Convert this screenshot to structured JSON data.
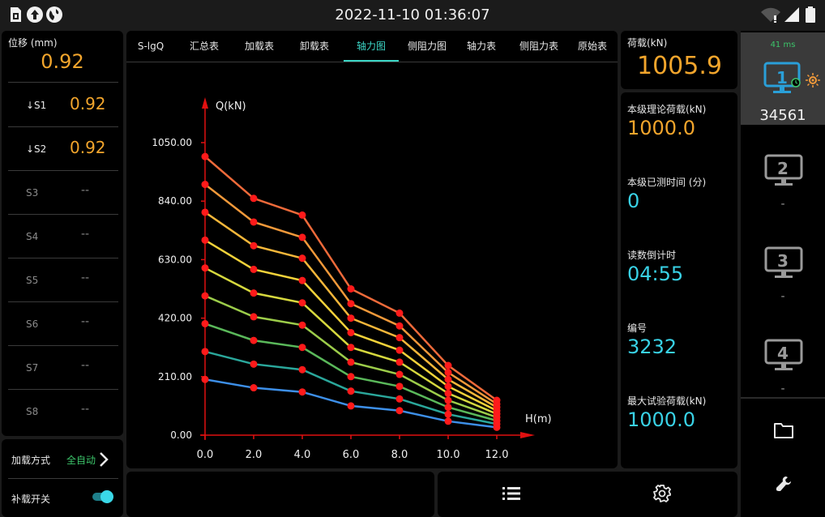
{
  "status": {
    "datetime": "2022-11-10 01:36:07",
    "left_icons": [
      "sim-card-icon",
      "upload-circle-icon",
      "globe-icon"
    ],
    "right_icons": [
      "wifi-off-icon",
      "signal-icon",
      "battery-icon"
    ]
  },
  "left": {
    "displacement_label": "位移 (mm)",
    "displacement_value": "0.92",
    "sensors": [
      {
        "label": "↓S1",
        "value": "0.92"
      },
      {
        "label": "↓S2",
        "value": "0.92"
      },
      {
        "label": "S3",
        "value": "--"
      },
      {
        "label": "S4",
        "value": "--"
      },
      {
        "label": "S5",
        "value": "--"
      },
      {
        "label": "S6",
        "value": "--"
      },
      {
        "label": "S7",
        "value": "--"
      },
      {
        "label": "S8",
        "value": "--"
      }
    ],
    "load_mode_label": "加载方式",
    "load_mode_value": "全自动",
    "supplement_label": "补载开关",
    "supplement_on": true
  },
  "tabs": [
    {
      "label": "S-lgQ",
      "active": false
    },
    {
      "label": "汇总表",
      "active": false
    },
    {
      "label": "加载表",
      "active": false
    },
    {
      "label": "卸载表",
      "active": false
    },
    {
      "label": "轴力图",
      "active": true
    },
    {
      "label": "侧阻力图",
      "active": false
    },
    {
      "label": "轴力表",
      "active": false
    },
    {
      "label": "侧阻力表",
      "active": false
    },
    {
      "label": "原始表",
      "active": false
    }
  ],
  "chart_data": {
    "type": "line",
    "ylabel": "Q(kN)",
    "xlabel": "H(m)",
    "x": [
      0,
      2,
      4,
      6,
      8,
      10,
      12
    ],
    "x_tick_labels": [
      "0.0",
      "2.0",
      "4.0",
      "6.0",
      "8.0",
      "10.0",
      "12.0"
    ],
    "y_ticks": [
      0,
      210,
      420,
      630,
      840,
      1050
    ],
    "y_tick_labels": [
      "0.00",
      "210.00",
      "420.00",
      "630.00",
      "840.00",
      "1050.00"
    ],
    "ylim": [
      0,
      1050
    ],
    "xlim": [
      0,
      12
    ],
    "grid": false,
    "point_color": "#ff1a1a",
    "axis_color": "#e01010",
    "series": [
      {
        "color": "#3d8fe8",
        "values": [
          200,
          170,
          155,
          105,
          88,
          50,
          28
        ]
      },
      {
        "color": "#2aa79b",
        "values": [
          300,
          255,
          235,
          158,
          130,
          75,
          40
        ]
      },
      {
        "color": "#5ab85a",
        "values": [
          400,
          340,
          315,
          210,
          175,
          100,
          52
        ]
      },
      {
        "color": "#9ccc4a",
        "values": [
          500,
          425,
          395,
          262,
          218,
          125,
          64
        ]
      },
      {
        "color": "#d6d83e",
        "values": [
          600,
          510,
          475,
          315,
          262,
          150,
          76
        ]
      },
      {
        "color": "#f2d23a",
        "values": [
          700,
          595,
          555,
          368,
          305,
          175,
          88
        ]
      },
      {
        "color": "#f5b73a",
        "values": [
          800,
          680,
          635,
          420,
          350,
          200,
          100
        ]
      },
      {
        "color": "#f2993a",
        "values": [
          900,
          765,
          710,
          472,
          392,
          225,
          112
        ]
      },
      {
        "color": "#ee6a3a",
        "values": [
          1000,
          850,
          790,
          525,
          438,
          250,
          125
        ]
      }
    ]
  },
  "right": {
    "load_label": "荷载(kN)",
    "load_value": "1005.9",
    "theory_load_label": "本级理论荷载(kN)",
    "theory_load_value": "1000.0",
    "measured_time_label": "本级已测时间 (分)",
    "measured_time_value": "0",
    "countdown_label": "读数倒计时",
    "countdown_value": "04:55",
    "number_label": "编号",
    "number_value": "3232",
    "max_load_label": "最大试验荷载(kN)",
    "max_load_value": "1000.0"
  },
  "monitors": [
    {
      "num": "1",
      "latency": "41 ms",
      "value": "34561",
      "active": true
    },
    {
      "num": "2",
      "value": "-",
      "active": false
    },
    {
      "num": "3",
      "value": "-",
      "active": false
    },
    {
      "num": "4",
      "value": "-",
      "active": false
    }
  ],
  "colors": {
    "accent_orange": "#f2a52c",
    "accent_cyan": "#39d2e6",
    "active_tab": "#3cd6c6",
    "monitor_active": "#2a9fd8"
  }
}
